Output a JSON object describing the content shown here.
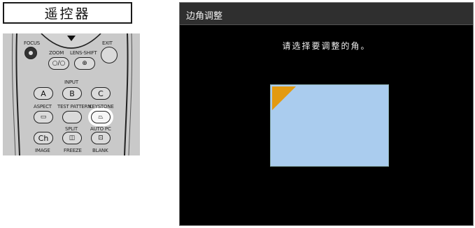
{
  "remote": {
    "header": "遥控器",
    "labels": {
      "focus": "FOCUS",
      "exit": "EXIT",
      "zoom": "ZOOM",
      "lens_shift": "LENS-SHIFT",
      "input": "INPUT",
      "aspect": "ASPECT",
      "test_pattern": "TEST PATTERN",
      "keystone": "KEYSTONE",
      "split": "SPLIT",
      "auto_pc": "AUTO PC",
      "image": "IMAGE",
      "freeze": "FREEZE",
      "blank": "BLANK"
    },
    "buttons": {
      "a": "A",
      "b": "B",
      "c": "C",
      "ch": "Ch"
    }
  },
  "dialog": {
    "title": "边角调整",
    "instruction": "请选择要调整的角。",
    "selected_corner": "top-left",
    "colors": {
      "screen": "#aaccee",
      "corner_marker": "#e39a10",
      "background": "#000000"
    }
  }
}
